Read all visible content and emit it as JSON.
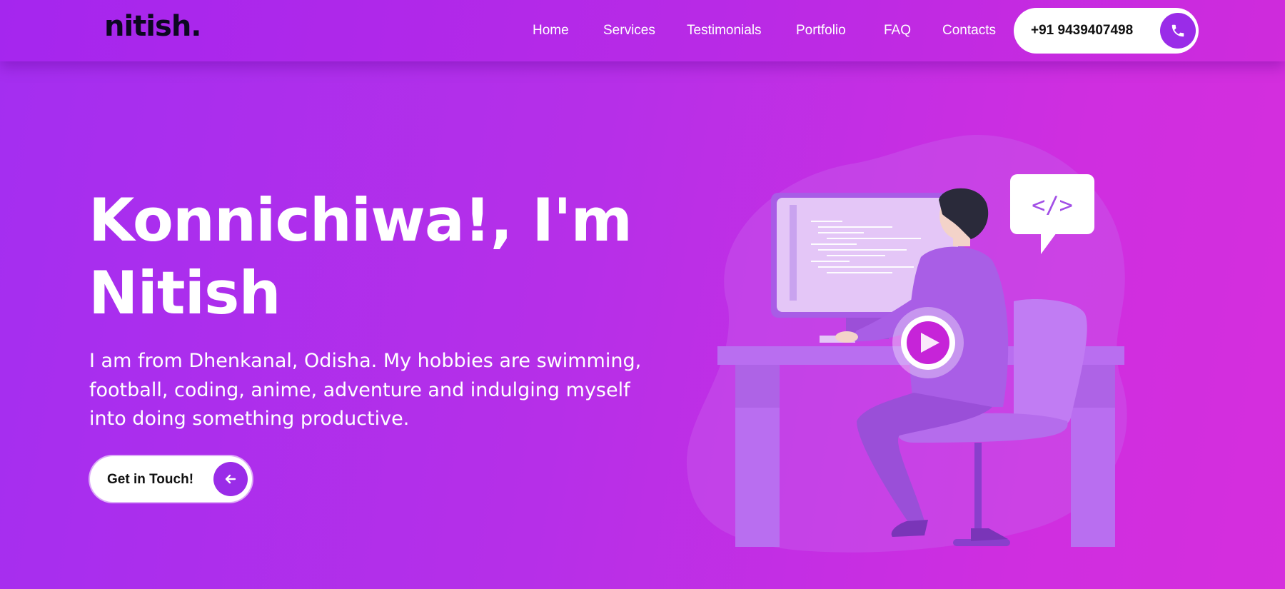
{
  "brand": {
    "logo": "nitish."
  },
  "nav": {
    "items": [
      {
        "label": "Home"
      },
      {
        "label": "Services"
      },
      {
        "label": "Testimonials"
      },
      {
        "label": "Portfolio"
      },
      {
        "label": "FAQ"
      },
      {
        "label": "Contacts"
      }
    ],
    "phone": "+91 9439407498",
    "phone_icon": "phone-icon"
  },
  "hero": {
    "title_line1": "Konnichiwa!, I'm",
    "title_line2": "Nitish",
    "description": "I am from Dhenkanal, Odisha. My hobbies are swimming, football, coding, anime, adventure and indulging myself into doing something productive.",
    "cta_label": "Get in Touch!",
    "cta_icon": "arrow-left-icon"
  },
  "illustration": {
    "code_tag": "</>",
    "play_icon": "play-icon"
  },
  "colors": {
    "accent": "#9a2ce8",
    "bg_start": "#a42ef0",
    "bg_end": "#d52edd"
  }
}
